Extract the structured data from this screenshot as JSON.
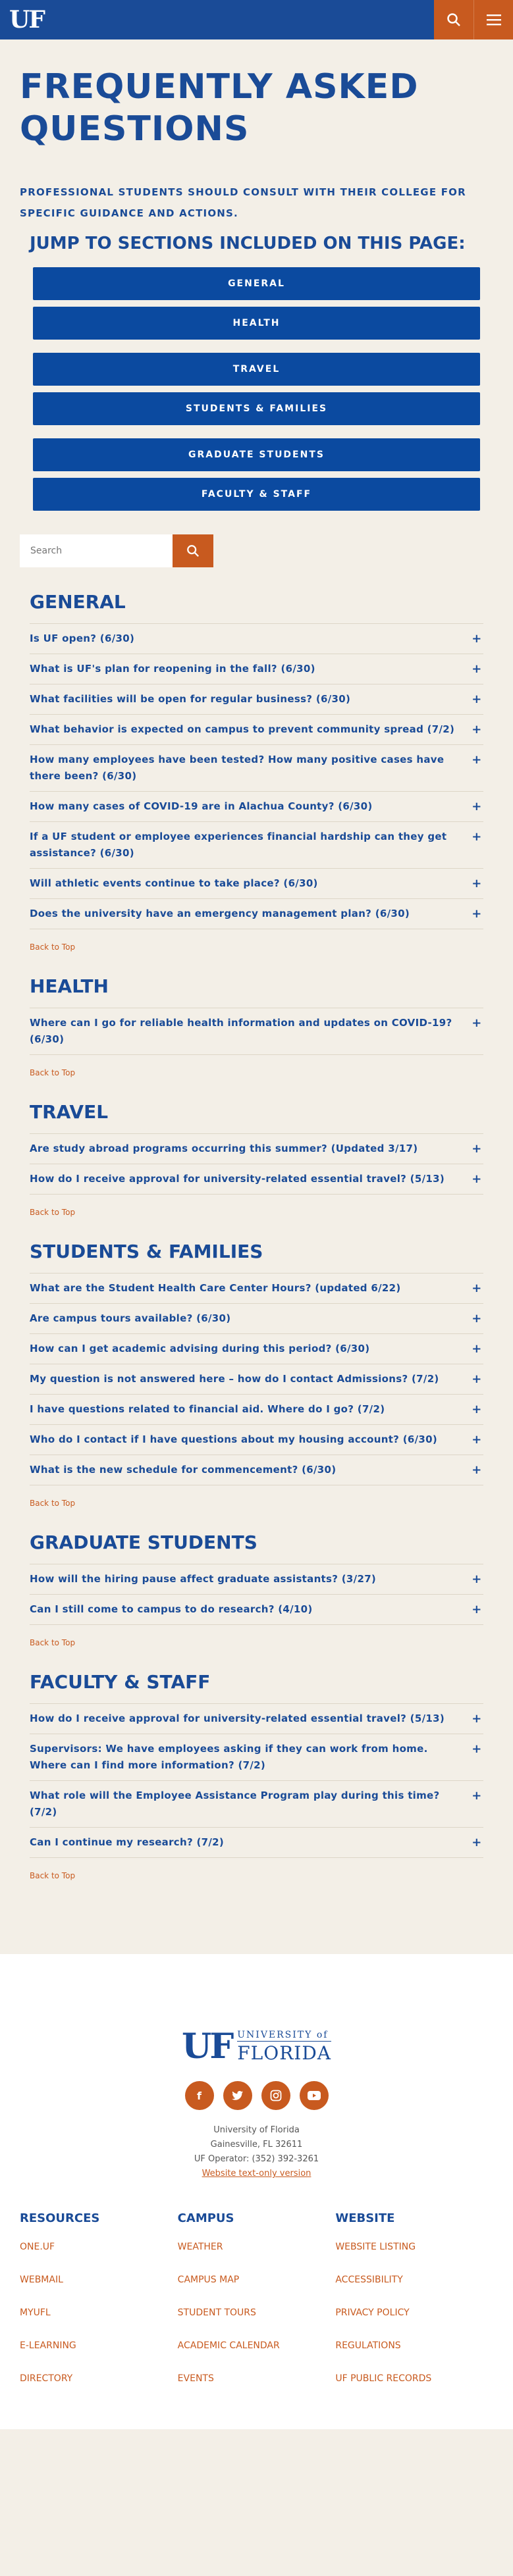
{
  "header": {
    "logo": "UF",
    "search_icon": "search-icon",
    "menu_icon": "menu-icon"
  },
  "page": {
    "title": "FREQUENTLY ASKED QUESTIONS",
    "intro": "PROFESSIONAL STUDENTS SHOULD CONSULT WITH THEIR COLLEGE FOR SPECIFIC GUIDANCE AND ACTIONS.",
    "jump_heading": "JUMP TO SECTIONS INCLUDED ON THIS PAGE:",
    "jump_buttons": [
      "GENERAL",
      "HEALTH",
      "TRAVEL",
      "STUDENTS & FAMILIES",
      "GRADUATE STUDENTS",
      "FACULTY & STAFF"
    ],
    "search_placeholder": "Search",
    "back_to_top": "Back to Top"
  },
  "sections": [
    {
      "title": "GENERAL",
      "questions": [
        "Is UF open? (6/30)",
        "What is UF's plan for reopening in the fall? (6/30)",
        "What facilities will be open for regular business? (6/30)",
        "What behavior is expected on campus to prevent community spread (7/2)",
        "How many employees have been tested? How many positive cases have there been? (6/30)",
        "How many cases of COVID-19 are in Alachua County? (6/30)",
        "If a UF student or employee experiences financial hardship can they get assistance? (6/30)",
        "Will athletic events continue to take place? (6/30)",
        "Does the university have an emergency management plan? (6/30)"
      ]
    },
    {
      "title": "HEALTH",
      "questions": [
        "Where can I go for reliable health information and updates on COVID-19? (6/30)"
      ]
    },
    {
      "title": "TRAVEL",
      "questions": [
        "Are study abroad programs occurring this summer? (Updated 3/17)",
        "How do I receive approval for university-related essential travel? (5/13)"
      ]
    },
    {
      "title": "STUDENTS & FAMILIES",
      "questions": [
        "What are the Student Health Care Center Hours? (updated 6/22)",
        "Are campus tours available? (6/30)",
        "How can I get academic advising during this period? (6/30)",
        "My question is not answered here – how do I contact Admissions? (7/2)",
        "I have questions related to financial aid. Where do I go? (7/2)",
        "Who do I contact if I have questions about my housing account? (6/30)",
        "What is the new schedule for commencement? (6/30)"
      ]
    },
    {
      "title": "GRADUATE STUDENTS",
      "questions": [
        "How will the hiring pause affect graduate assistants? (3/27)",
        "Can I still come to campus to do research? (4/10)"
      ]
    },
    {
      "title": "FACULTY & STAFF",
      "questions": [
        "How do I receive approval for university-related essential travel? (5/13)",
        "Supervisors: We have employees asking if they can work from home. Where can I find more information? (7/2)",
        "What role will the Employee Assistance Program play during this time? (7/2)",
        "Can I continue my research? (7/2)"
      ]
    }
  ],
  "footer": {
    "logo_uf": "UF",
    "logo_small": "UNIVERSITY of",
    "logo_large": "FLORIDA",
    "socials": [
      "facebook-icon",
      "twitter-icon",
      "instagram-icon",
      "youtube-icon"
    ],
    "address": [
      "University of Florida",
      "Gainesville, FL 32611",
      "UF Operator: (352) 392-3261"
    ],
    "text_only_link": "Website text-only version",
    "columns": [
      {
        "title": "RESOURCES",
        "links": [
          "ONE.UF",
          "WEBMAIL",
          "MYUFL",
          "E-LEARNING",
          "DIRECTORY"
        ]
      },
      {
        "title": "CAMPUS",
        "links": [
          "WEATHER",
          "CAMPUS MAP",
          "STUDENT TOURS",
          "ACADEMIC CALENDAR",
          "EVENTS"
        ]
      },
      {
        "title": "WEBSITE",
        "links": [
          "WEBSITE LISTING",
          "ACCESSIBILITY",
          "PRIVACY POLICY",
          "REGULATIONS",
          "UF PUBLIC RECORDS"
        ]
      }
    ]
  },
  "colors": {
    "blue": "#1a4b97",
    "orange": "#c85a1f",
    "background": "#f3efe7"
  }
}
